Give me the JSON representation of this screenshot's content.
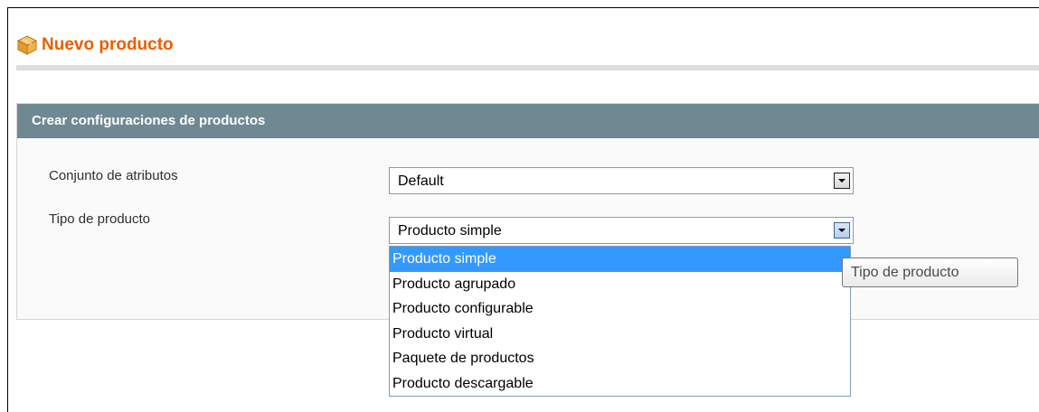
{
  "header": {
    "title": "Nuevo producto",
    "icon": "box-icon"
  },
  "fieldset": {
    "title": "Crear configuraciones de productos",
    "fields": [
      {
        "label": "Conjunto de atributos",
        "value": "Default"
      },
      {
        "label": "Tipo de producto",
        "value": "Producto simple"
      }
    ]
  },
  "dropdown": {
    "options": [
      "Producto simple",
      "Producto agrupado",
      "Producto configurable",
      "Producto virtual",
      "Paquete de productos",
      "Producto descargable"
    ],
    "selected": "Producto simple"
  },
  "tooltip": {
    "text": "Tipo de producto"
  },
  "colors": {
    "title": "#eb5e00",
    "section_header_bg": "#6f8992",
    "selection": "#3399ff"
  }
}
